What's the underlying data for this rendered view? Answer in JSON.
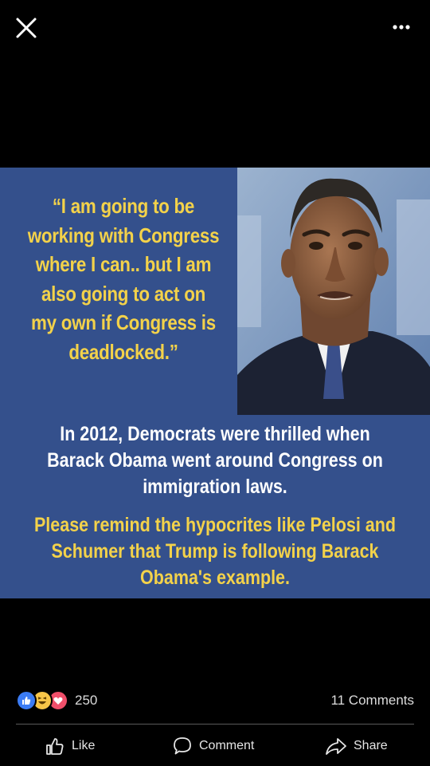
{
  "top_bar": {
    "close_icon": "close-icon",
    "more_icon": "more-options-icon"
  },
  "post_image": {
    "quote": "“I am going to be working with Congress where I can.. but I am also going to act on my own if Congress is deadlocked.”",
    "statement": "In 2012, Democrats were thrilled when Barack Obama went around Congress on immigration laws.",
    "reminder": "Please remind the hypocrites like Pelosi and Schumer that Trump is following Barack Obama's example.",
    "colors": {
      "background": "#34508c",
      "quote_text": "#f3d24a",
      "statement_text": "#ffffff"
    }
  },
  "engagement": {
    "reaction_icons": [
      "like-reaction-icon",
      "haha-reaction-icon",
      "love-reaction-icon"
    ],
    "reaction_count": "250",
    "comments": "11 Comments"
  },
  "actions": {
    "like": "Like",
    "comment": "Comment",
    "share": "Share"
  }
}
